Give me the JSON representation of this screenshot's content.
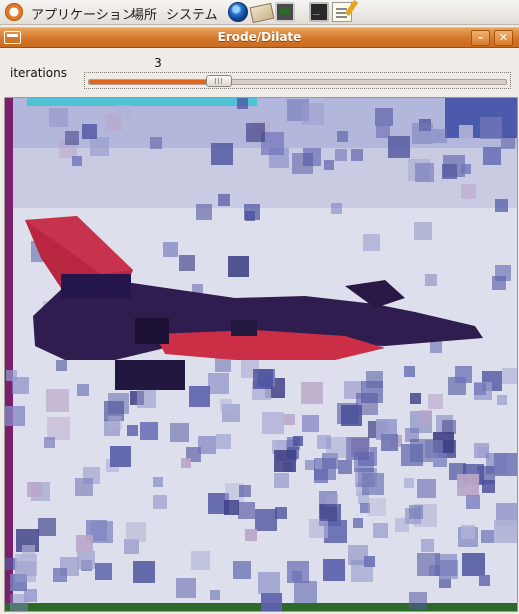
{
  "top_panel": {
    "menus": [
      "アプリケーション",
      "場所",
      "システム"
    ],
    "launchers": [
      "globe-icon",
      "mail-icon",
      "monitor-icon",
      "terminal-icon",
      "text-editor-icon"
    ]
  },
  "window": {
    "title": "Erode/Dilate",
    "buttons": [
      "minimize",
      "close"
    ]
  },
  "controls": {
    "iterations_label": "iterations",
    "iterations_value": "3",
    "slider_fraction": 0.16
  },
  "image": {
    "description": "eroded/dilated image of a jet aircraft over white clouds",
    "colors": {
      "sky": "#dfe2ee",
      "cloud_blue": "#5a5ea4",
      "aircraft_dark": "#2a1a4a",
      "aircraft_red": "#c8284a",
      "accent": "#e2631a"
    }
  }
}
